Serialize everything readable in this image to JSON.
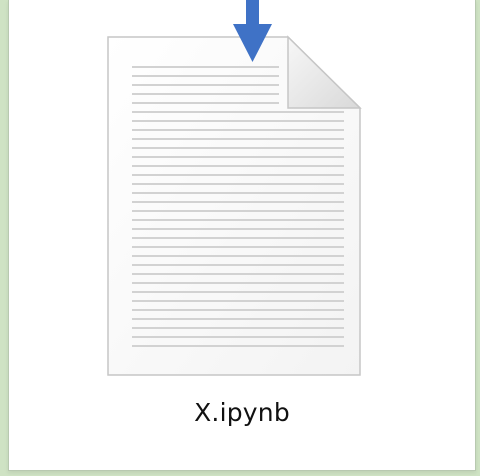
{
  "file": {
    "name": "X.ipynb",
    "icon": "document-file-icon"
  },
  "pointer": {
    "icon": "down-arrow-icon",
    "color": "#3f72c6"
  },
  "colors": {
    "background": "#cfe3c4",
    "panel": "#ffffff",
    "page_fill": "#fbfbfb",
    "page_border": "#c8c8c8",
    "lines": "#d4d4d4",
    "fold_fill": "#ececec"
  }
}
